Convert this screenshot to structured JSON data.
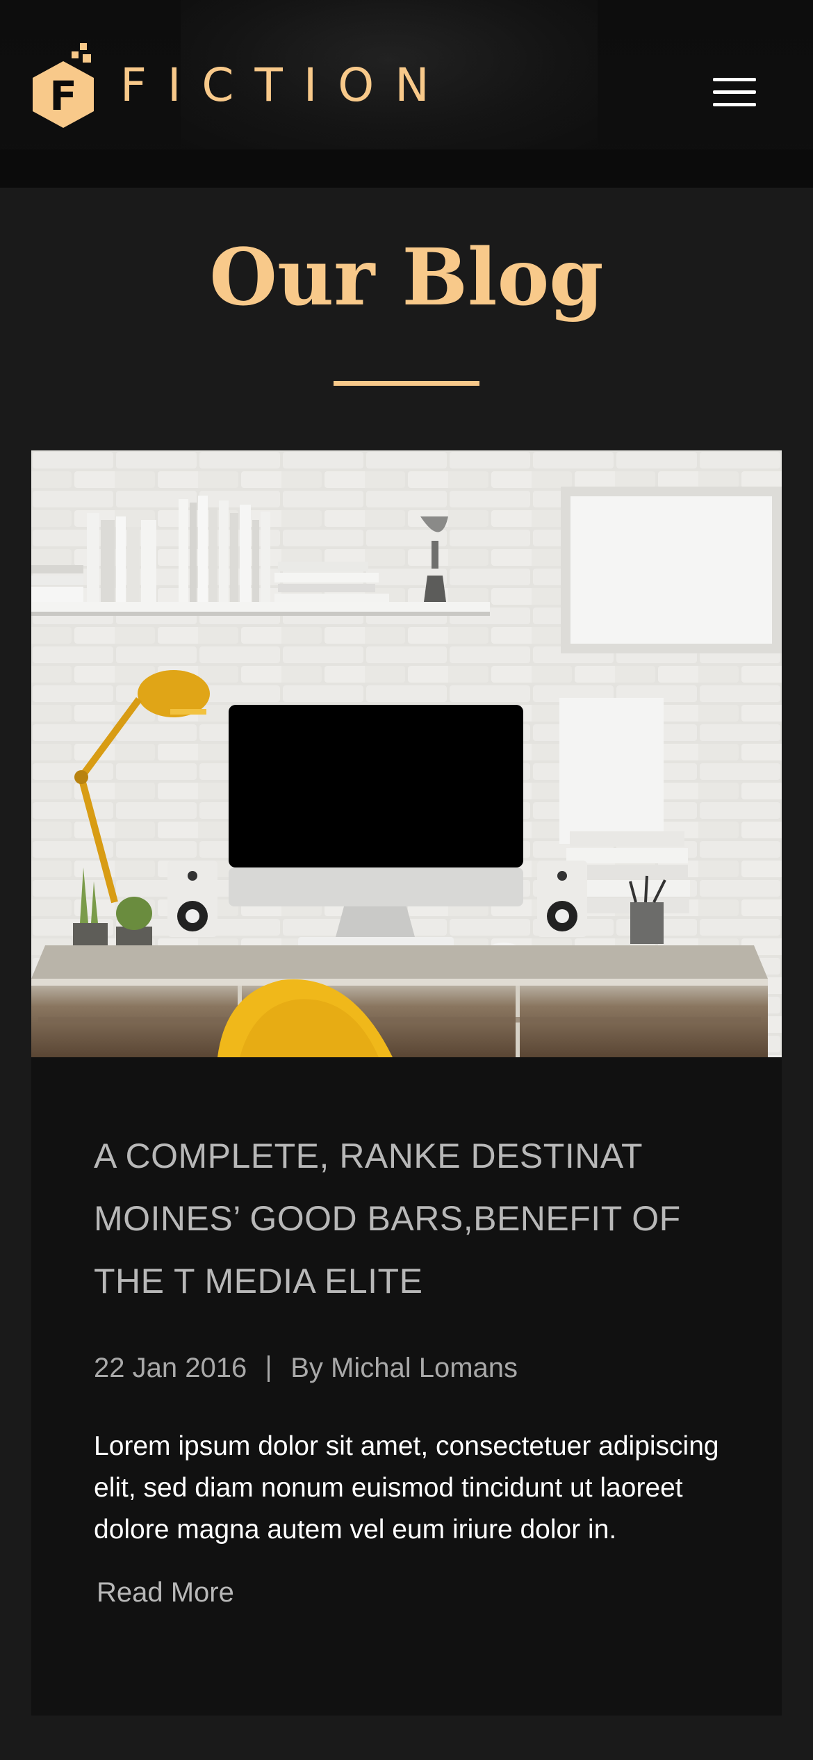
{
  "header": {
    "logo_letter": "F",
    "logo_text": "FICTION",
    "brand_color": "#f8c98a",
    "menu_icon": "hamburger-menu-icon"
  },
  "page": {
    "title": "Our Blog"
  },
  "post": {
    "image_alt": "desk-workspace-photo",
    "title": "A COMPLETE, RANKE DESTINAT MOINES’ GOOD BARS,BENEFIT OF THE T MEDIA ELITE",
    "date": "22 Jan 2016",
    "author": "By Michal Lomans",
    "excerpt": "Lorem ipsum dolor sit amet, consectetuer adipiscing elit, sed diam nonum euismod tincidunt ut laoreet dolore magna autem vel eum iriure dolor in.",
    "read_more": "Read More"
  }
}
